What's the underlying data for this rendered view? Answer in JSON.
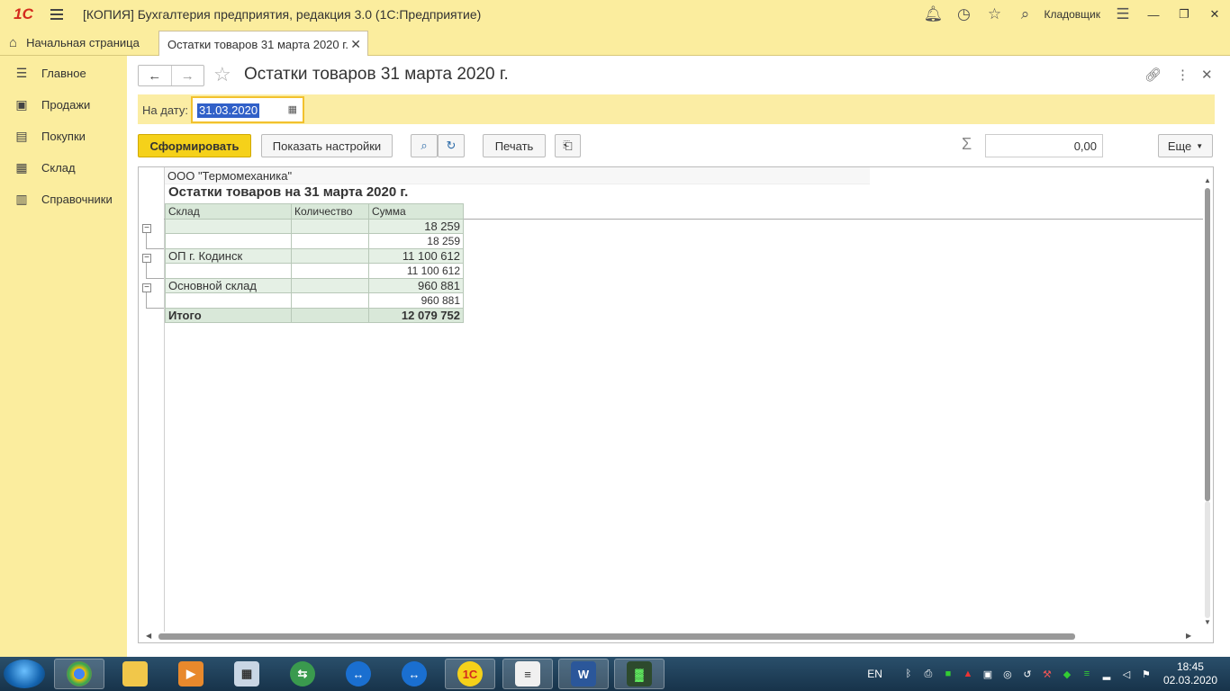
{
  "app": {
    "title": "[КОПИЯ] Бухгалтерия предприятия, редакция 3.0  (1С:Предприятие)",
    "logo": "1С",
    "username": "Кладовщик"
  },
  "tabs": {
    "home": "Начальная страница",
    "active": "Остатки товаров 31 марта 2020 г."
  },
  "sidebar": {
    "items": [
      {
        "label": "Главное",
        "icon": "list-icon"
      },
      {
        "label": "Продажи",
        "icon": "bag-icon"
      },
      {
        "label": "Покупки",
        "icon": "cart-icon"
      },
      {
        "label": "Склад",
        "icon": "grid-icon"
      },
      {
        "label": "Справочники",
        "icon": "book-icon"
      }
    ]
  },
  "form": {
    "title": "Остатки товаров 31 марта 2020 г.",
    "date_label": "На дату:",
    "date_value": "31.03.2020",
    "generate_label": "Сформировать",
    "settings_label": "Показать настройки",
    "print_label": "Печать",
    "sum_value": "0,00",
    "more_label": "Еще"
  },
  "report": {
    "company": "ООО \"Термомеханика\"",
    "title": "Остатки товаров на 31 марта 2020 г.",
    "columns": [
      "Склад",
      "Количество",
      "Сумма"
    ],
    "rows": [
      {
        "type": "grp",
        "warehouse": "",
        "qty": "",
        "sum": "18 259"
      },
      {
        "type": "det",
        "warehouse": "",
        "qty": "",
        "sum": "18 259"
      },
      {
        "type": "grp",
        "warehouse": "ОП г. Кодинск",
        "qty": "",
        "sum": "11 100 612"
      },
      {
        "type": "det",
        "warehouse": "",
        "qty": "",
        "sum": "11 100 612"
      },
      {
        "type": "grp",
        "warehouse": "Основной склад",
        "qty": "",
        "sum": "960 881"
      },
      {
        "type": "det",
        "warehouse": "",
        "qty": "",
        "sum": "960 881"
      }
    ],
    "total": {
      "label": "Итого",
      "qty": "",
      "sum": "12 079 752"
    }
  },
  "taskbar": {
    "lang": "EN",
    "time": "18:45",
    "date": "02.03.2020"
  }
}
